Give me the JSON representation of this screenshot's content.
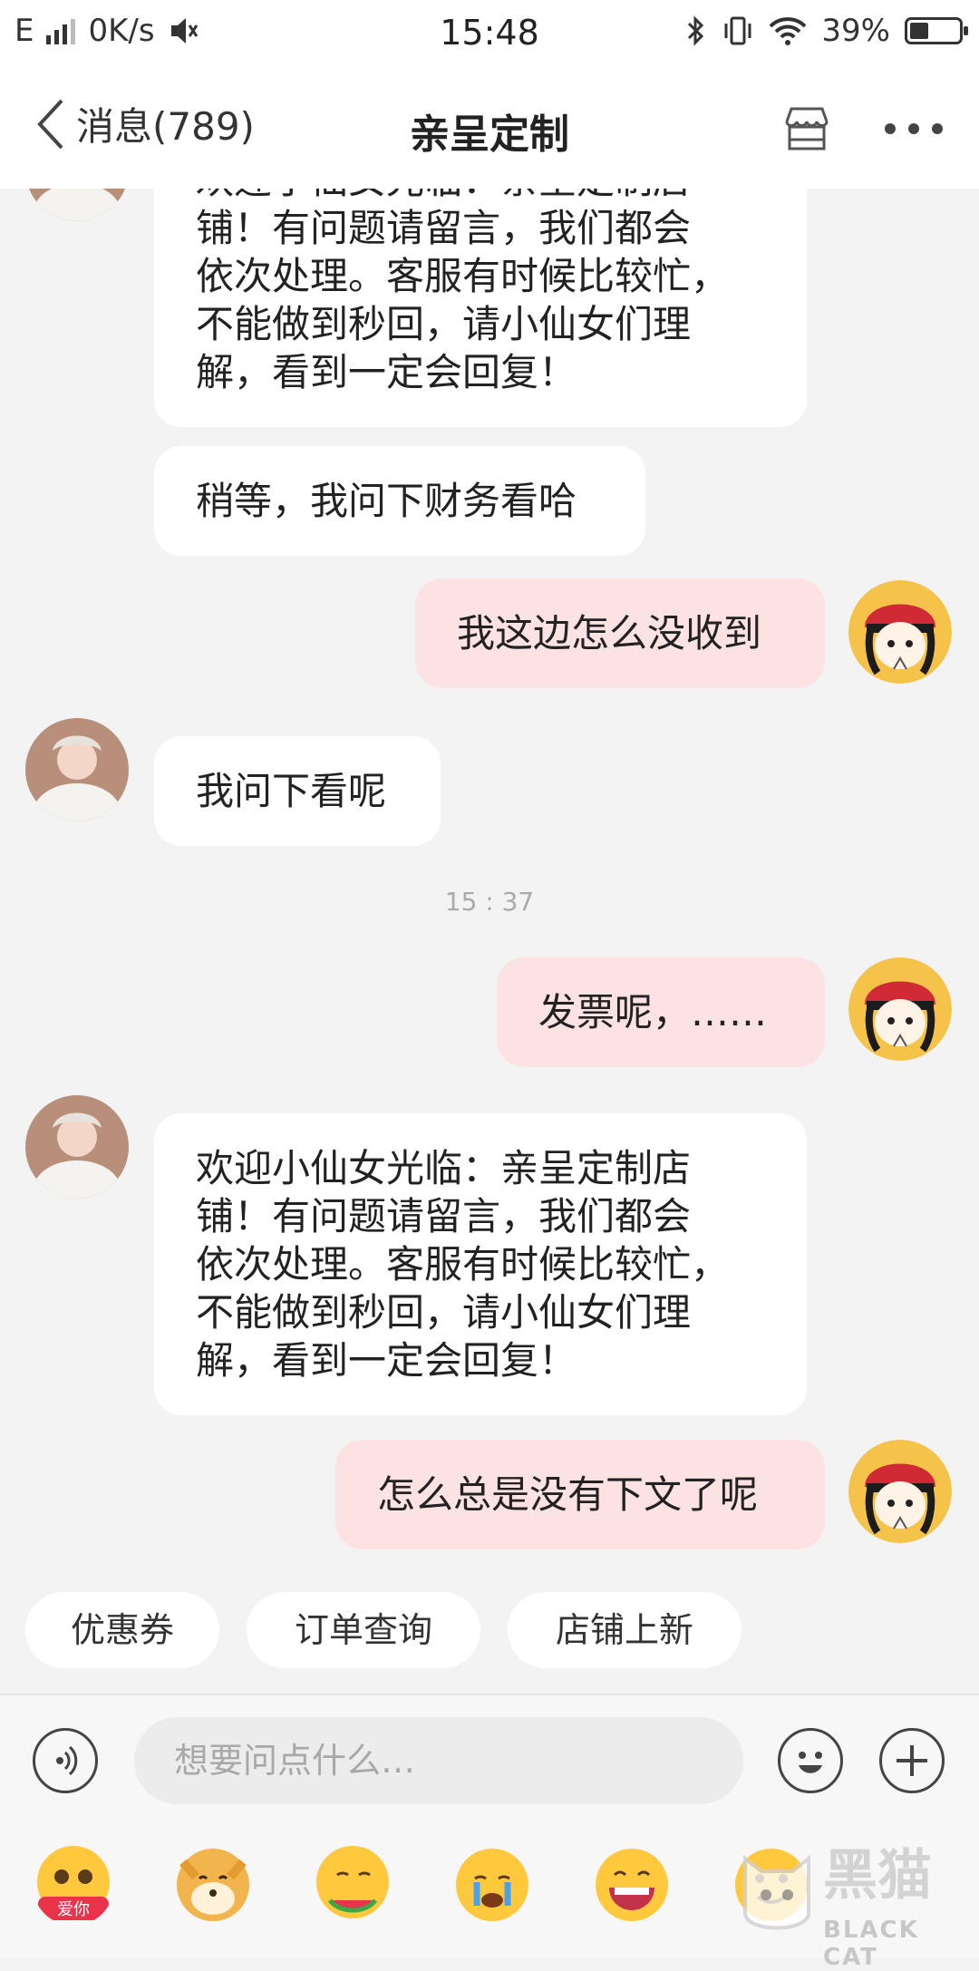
{
  "status_bar": {
    "network": "E",
    "speed": "0K/s",
    "time": "15:48",
    "battery": "39%",
    "battery_level": 0.39
  },
  "nav": {
    "back_label": "消息(789)",
    "title": "亲呈定制"
  },
  "messages": [
    {
      "from": "shop",
      "lines": [
        "欢迎小仙女光临：亲呈定制店",
        "铺！有问题请留言，我们都会",
        "依次处理。客服有时候比较忙，",
        "不能做到秒回，请小仙女们理",
        "解，看到一定会回复！"
      ]
    },
    {
      "from": "shop",
      "lines": [
        "稍等，我问下财务看哈"
      ]
    },
    {
      "from": "me",
      "lines": [
        "我这边怎么没收到"
      ]
    },
    {
      "from": "shop",
      "lines": [
        "我问下看呢"
      ]
    },
    {
      "from": "me",
      "lines": [
        "发票呢，……"
      ]
    },
    {
      "from": "shop",
      "lines": [
        "欢迎小仙女光临：亲呈定制店",
        "铺！有问题请留言，我们都会",
        "依次处理。客服有时候比较忙，",
        "不能做到秒回，请小仙女们理",
        "解，看到一定会回复！"
      ]
    },
    {
      "from": "me",
      "lines": [
        "怎么总是没有下文了呢"
      ]
    }
  ],
  "timestamp": "15 : 37",
  "quick_replies": [
    "优惠券",
    "订单查询",
    "店铺上新"
  ],
  "input": {
    "placeholder": "想要问点什么…"
  },
  "emoji_badge": "爱你",
  "watermark": {
    "text": "黑猫",
    "sub": "BLACK CAT"
  },
  "colors": {
    "my_bubble": "#fde2e4",
    "shop_bubble": "#ffffff",
    "background": "#f3f3f3"
  }
}
